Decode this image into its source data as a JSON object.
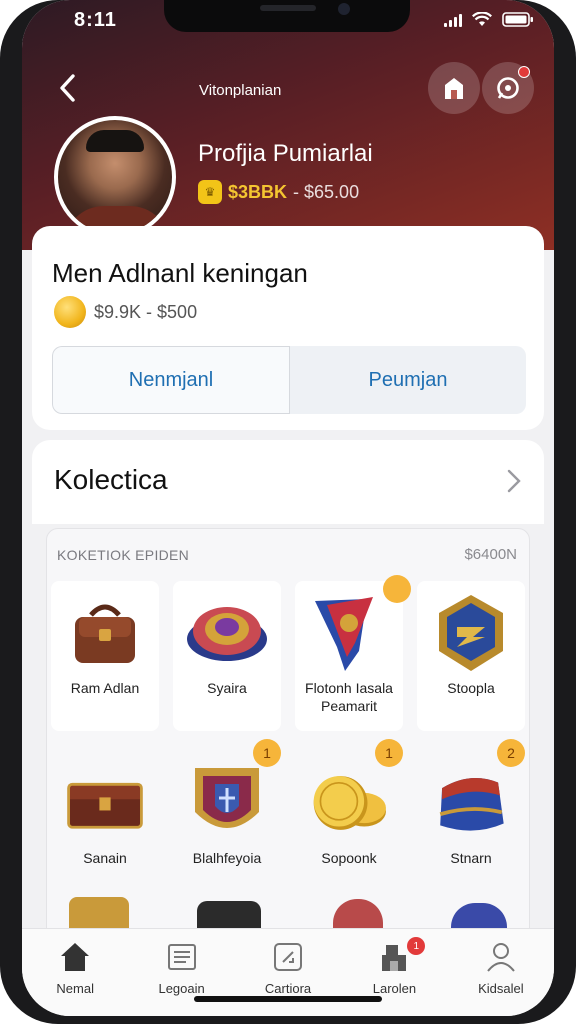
{
  "status_bar": {
    "time": "8:11"
  },
  "header": {
    "title": "Vitonplanian",
    "profile_name": "Profjia Pumiarlai",
    "coin_gold": "$3BBK",
    "coin_rest": "- $65.00"
  },
  "card": {
    "title": "Men Adlnanl keningan",
    "price": "$9.9K - $500"
  },
  "tabs": [
    {
      "label": "Nenmjanl"
    },
    {
      "label": "Peumjan"
    }
  ],
  "collection": {
    "title": "Kolectica",
    "label": "KOKETIOK EPIDEN",
    "total": "$6400N"
  },
  "items": [
    {
      "label": "Ram Adlan",
      "icon": "satchel-icon",
      "badge": ""
    },
    {
      "label": "Syaira",
      "icon": "shield-icon",
      "badge": ""
    },
    {
      "label": "Flotonh Iasala Peamarit",
      "icon": "banner-icon",
      "badge": ""
    },
    {
      "label": "Stoopla",
      "icon": "emblem-icon",
      "badge": ""
    },
    {
      "label": "Sanain",
      "icon": "chest-icon",
      "badge": ""
    },
    {
      "label": "Blalhfeyoia",
      "icon": "crest-icon",
      "badge": "1"
    },
    {
      "label": "Sopoonk",
      "icon": "coins-icon",
      "badge": "1"
    },
    {
      "label": "Stnarn",
      "icon": "bracer-icon",
      "badge": "2"
    }
  ],
  "bottom_nav": [
    {
      "label": "Nemal",
      "icon": "home-icon"
    },
    {
      "label": "Legoain",
      "icon": "book-icon"
    },
    {
      "label": "Cartiora",
      "icon": "edit-icon"
    },
    {
      "label": "Larolen",
      "icon": "store-icon",
      "badge": "1"
    },
    {
      "label": "Kidsalel",
      "icon": "profile-icon"
    }
  ]
}
